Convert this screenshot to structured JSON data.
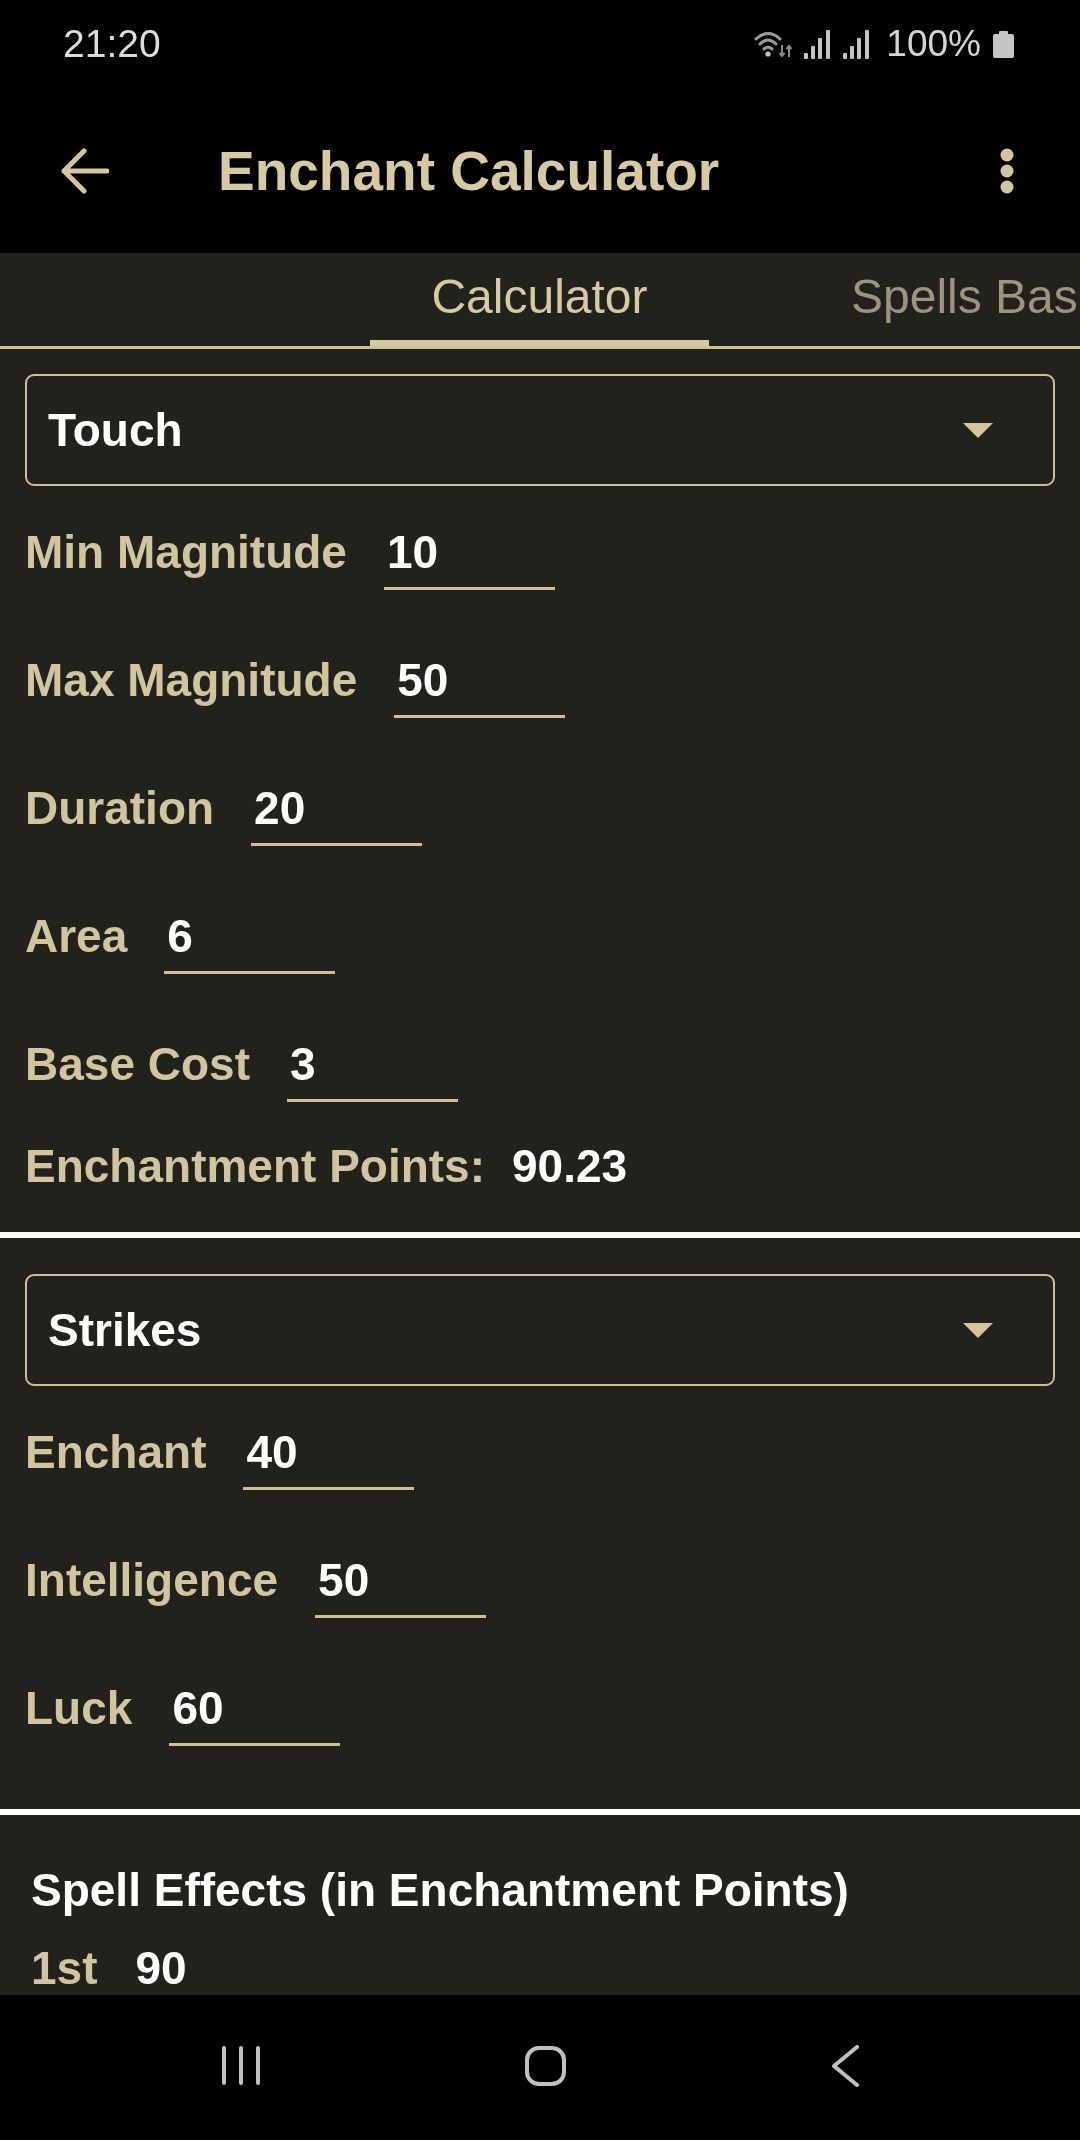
{
  "status_bar": {
    "time": "21:20",
    "battery": "100%"
  },
  "app_bar": {
    "title": "Enchant Calculator"
  },
  "tabs": [
    {
      "label": "Calculator",
      "selected": true
    },
    {
      "label": "Spells Bas",
      "selected": false
    }
  ],
  "spell": {
    "dropdown": {
      "value": "Touch"
    },
    "fields": [
      {
        "label": "Min Magnitude",
        "value": "10"
      },
      {
        "label": "Max Magnitude",
        "value": "50"
      },
      {
        "label": "Duration",
        "value": "20"
      },
      {
        "label": "Area",
        "value": "6"
      },
      {
        "label": "Base Cost",
        "value": "3"
      }
    ],
    "result": {
      "label": "Enchantment Points:",
      "value": "90.23"
    }
  },
  "character": {
    "dropdown": {
      "value": "Strikes"
    },
    "fields": [
      {
        "label": "Enchant",
        "value": "40"
      },
      {
        "label": "Intelligence",
        "value": "50"
      },
      {
        "label": "Luck",
        "value": "60"
      }
    ]
  },
  "spell_effects": {
    "title": "Spell Effects (in Enchantment Points)",
    "rows": [
      {
        "label": "1st",
        "value": "90"
      }
    ]
  }
}
